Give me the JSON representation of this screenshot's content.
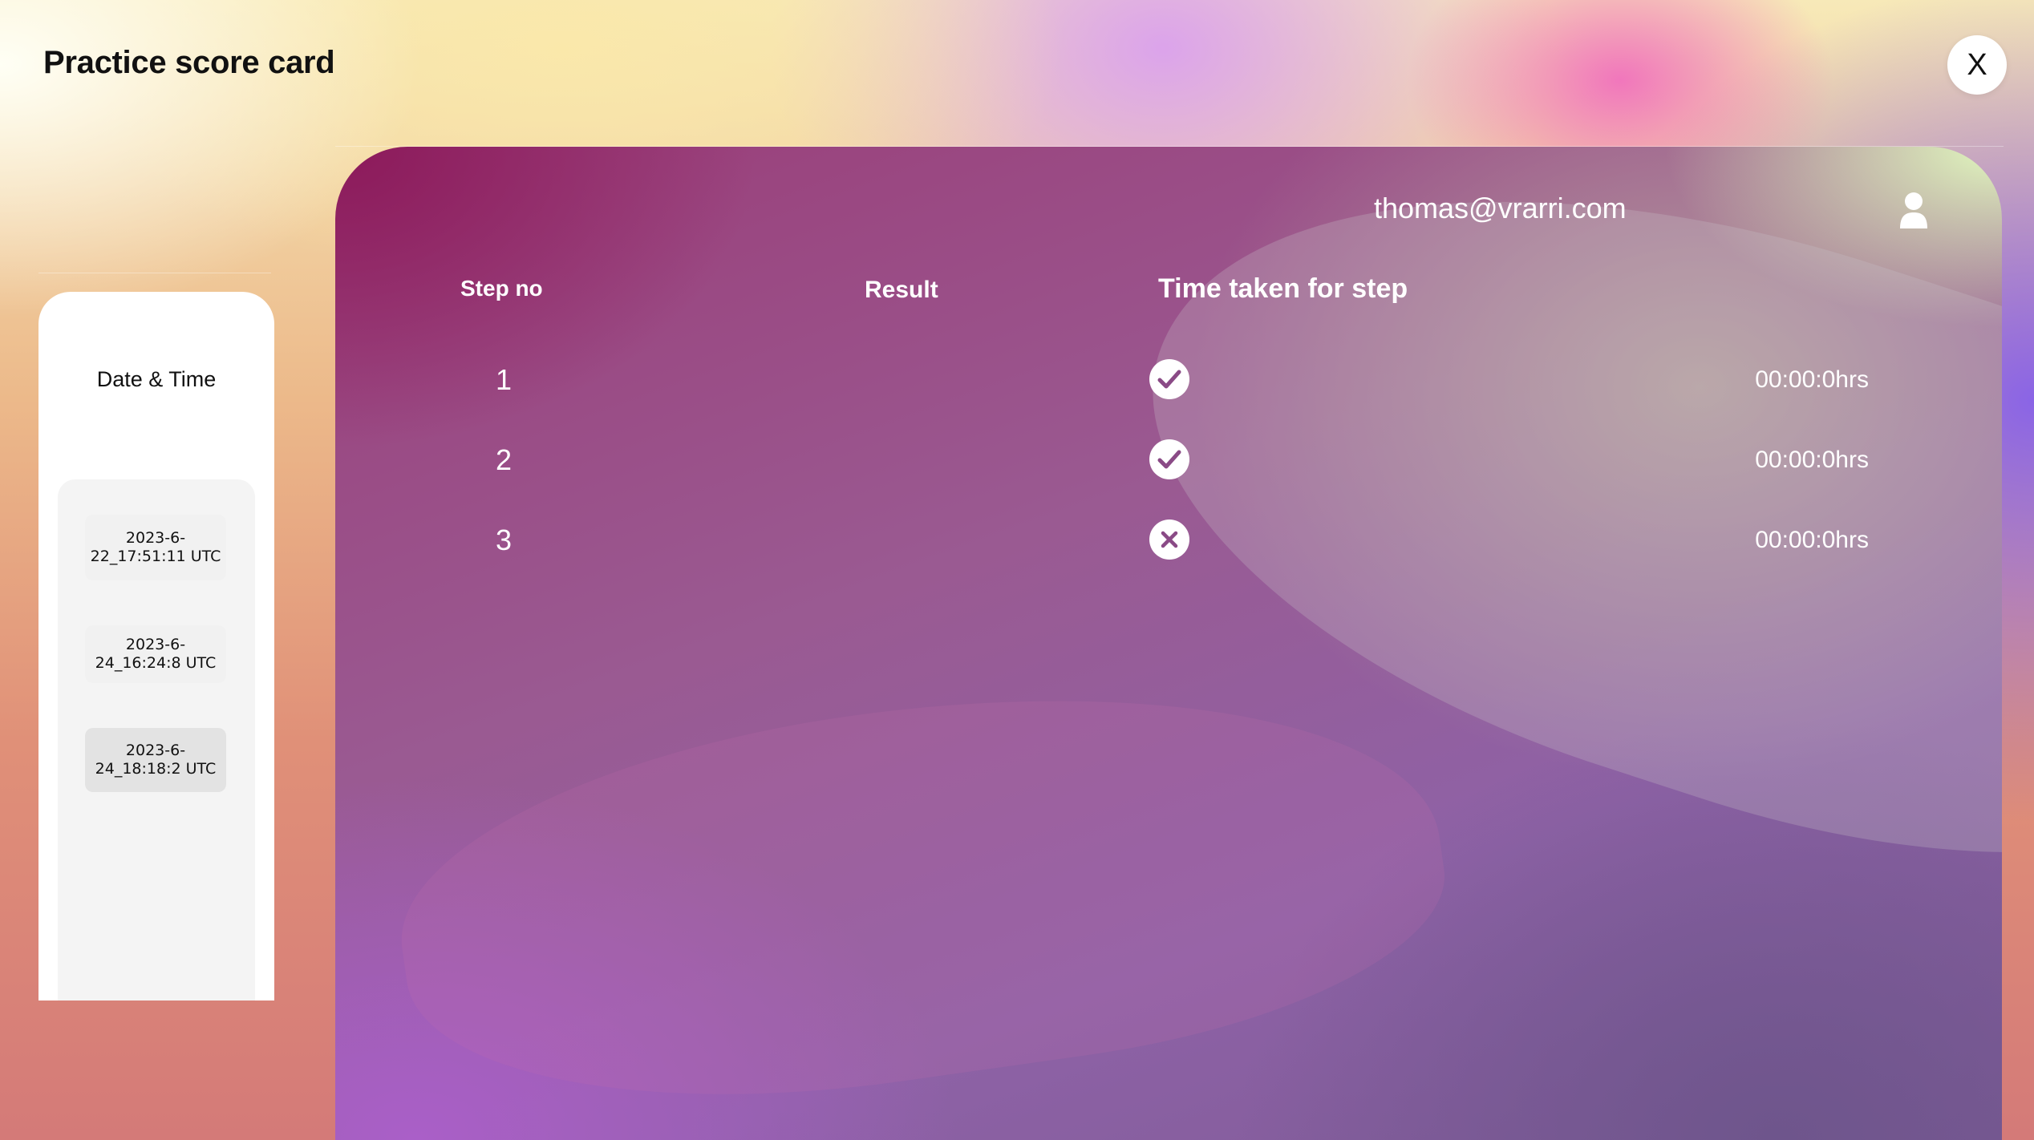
{
  "header": {
    "title": "Practice score card",
    "close_label": "X"
  },
  "sidebar": {
    "title": "Date & Time",
    "dates": [
      "2023-6-22_17:51:11 UTC",
      "2023-6-24_16:24:8 UTC",
      "2023-6-24_18:18:2 UTC"
    ],
    "selected_index": 2
  },
  "card": {
    "user_email": "thomas@vrarri.com",
    "columns": {
      "step": "Step no",
      "result": "Result",
      "time": "Time taken for step"
    },
    "rows": [
      {
        "step": "1",
        "result": "pass",
        "result_icon": "check-circle-icon",
        "time": "00:00:0hrs"
      },
      {
        "step": "2",
        "result": "pass",
        "result_icon": "check-circle-icon",
        "time": "00:00:0hrs"
      },
      {
        "step": "3",
        "result": "fail",
        "result_icon": "x-circle-icon",
        "time": "00:00:0hrs"
      }
    ]
  },
  "colors": {
    "card_top_left": "#8c195a",
    "card_top_right": "#e1fabe",
    "icon_fill": "#ffffff",
    "icon_mark": "#8a4a86"
  }
}
